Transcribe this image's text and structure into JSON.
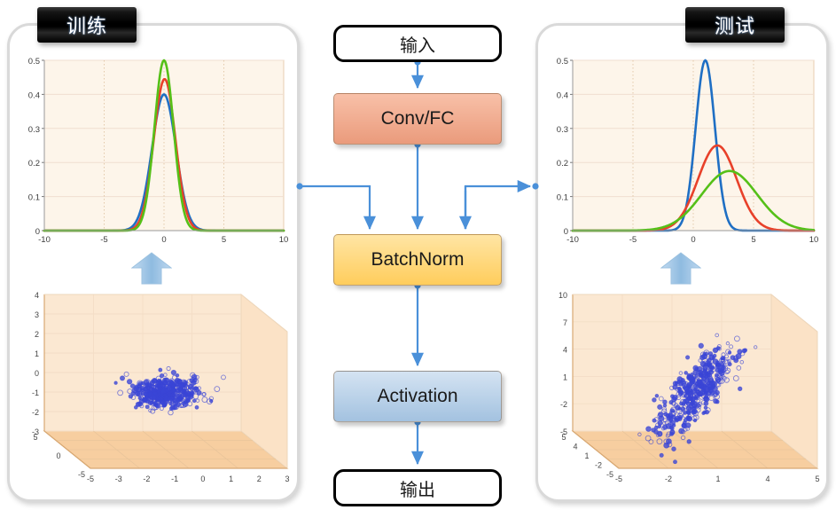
{
  "panels": {
    "train": {
      "title": "训练"
    },
    "test": {
      "title": "测试"
    }
  },
  "flow": {
    "input_label": "输入",
    "conv_label": "Conv/FC",
    "batchnorm_label": "BatchNorm",
    "activation_label": "Activation",
    "output_label": "输出"
  },
  "colors": {
    "conv_fill_top": "#f6b9a0",
    "conv_fill_bottom": "#eb9d7f",
    "batchnorm_fill_top": "#ffe093",
    "batchnorm_fill_bottom": "#ffcf63",
    "activation_fill_top": "#cfe0f0",
    "activation_fill_bottom": "#a8c6e2",
    "connector_blue": "#4a90d9",
    "panel_border": "#d9d9d9",
    "plot_bg": "#fdf5ea",
    "grid_line": "#f0ded0",
    "curve_blue": "#1f6fc4",
    "curve_red": "#e8412a",
    "curve_green": "#55c018",
    "scatter_point": "#3a45d6",
    "floor_fill": "#f7ceA0",
    "wall_fill": "#fbe8d2",
    "up_arrow": "#9fc5e8",
    "badge_text": "#ffffff"
  },
  "chart_data": [
    {
      "id": "train-distribution",
      "type": "line",
      "title": "训练 distribution",
      "xlabel": "",
      "ylabel": "",
      "xlim": [
        -10,
        10
      ],
      "ylim": [
        0,
        0.5
      ],
      "xticks": [
        "-10",
        "-5",
        "0",
        "5",
        "10"
      ],
      "yticks": [
        "0",
        "0.1",
        "0.2",
        "0.3",
        "0.4",
        "0.5"
      ],
      "grid": true,
      "legend": "none",
      "series": [
        {
          "name": "blue",
          "color": "#1f6fc4",
          "mean": 0.0,
          "sigma": 1.0,
          "peak": 0.4
        },
        {
          "name": "red",
          "color": "#e8412a",
          "mean": 0.05,
          "sigma": 0.9,
          "peak": 0.445
        },
        {
          "name": "green",
          "color": "#55c018",
          "mean": 0.0,
          "sigma": 0.8,
          "peak": 0.5
        }
      ]
    },
    {
      "id": "test-distribution",
      "type": "line",
      "title": "测试 distribution",
      "xlabel": "",
      "ylabel": "",
      "xlim": [
        -10,
        10
      ],
      "ylim": [
        0,
        0.5
      ],
      "xticks": [
        "-10",
        "-5",
        "0",
        "5",
        "10"
      ],
      "yticks": [
        "0",
        "0.1",
        "0.2",
        "0.3",
        "0.4",
        "0.5"
      ],
      "grid": true,
      "legend": "none",
      "series": [
        {
          "name": "blue",
          "color": "#1f6fc4",
          "mean": 1.0,
          "sigma": 0.8,
          "peak": 0.5
        },
        {
          "name": "red",
          "color": "#e8412a",
          "mean": 2.0,
          "sigma": 1.6,
          "peak": 0.25
        },
        {
          "name": "green",
          "color": "#55c018",
          "mean": 3.0,
          "sigma": 2.3,
          "peak": 0.175
        }
      ]
    },
    {
      "id": "train-scatter3d",
      "type": "scatter",
      "title": "训练 3D scatter",
      "xlim": [
        -5,
        3
      ],
      "ylim": [
        -5,
        5
      ],
      "zlim": [
        -3,
        4
      ],
      "xticks": [
        "-5",
        "-3",
        "-2",
        "-1",
        "0",
        "1",
        "2",
        "3"
      ],
      "yticks": [
        "5",
        "0",
        "-5"
      ],
      "zticks": [
        "4",
        "3",
        "2",
        "1",
        "0",
        "-1",
        "-2",
        "-3"
      ],
      "n_points": 420,
      "cluster_center": [
        -0.7,
        0.0,
        -0.9
      ],
      "cluster_spread": [
        1.0,
        1.0,
        0.75
      ],
      "point_color": "#3a45d6",
      "grid": true
    },
    {
      "id": "test-scatter3d",
      "type": "scatter",
      "title": "测试 3D scatter",
      "xlim": [
        -5,
        5
      ],
      "ylim": [
        -5,
        5
      ],
      "zlim": [
        -5,
        10
      ],
      "xticks": [
        "-5",
        "-2",
        "1",
        "4",
        "5"
      ],
      "yticks": [
        "5",
        "4",
        "1",
        "-2",
        "-5"
      ],
      "zticks": [
        "10",
        "7",
        "4",
        "1",
        "-2",
        "-5"
      ],
      "n_points": 430,
      "cluster_center": [
        -0.2,
        0.2,
        1.0
      ],
      "cluster_spread": [
        1.3,
        1.3,
        2.4
      ],
      "correlation": 0.75,
      "point_color": "#3a45d6",
      "grid": true
    }
  ]
}
